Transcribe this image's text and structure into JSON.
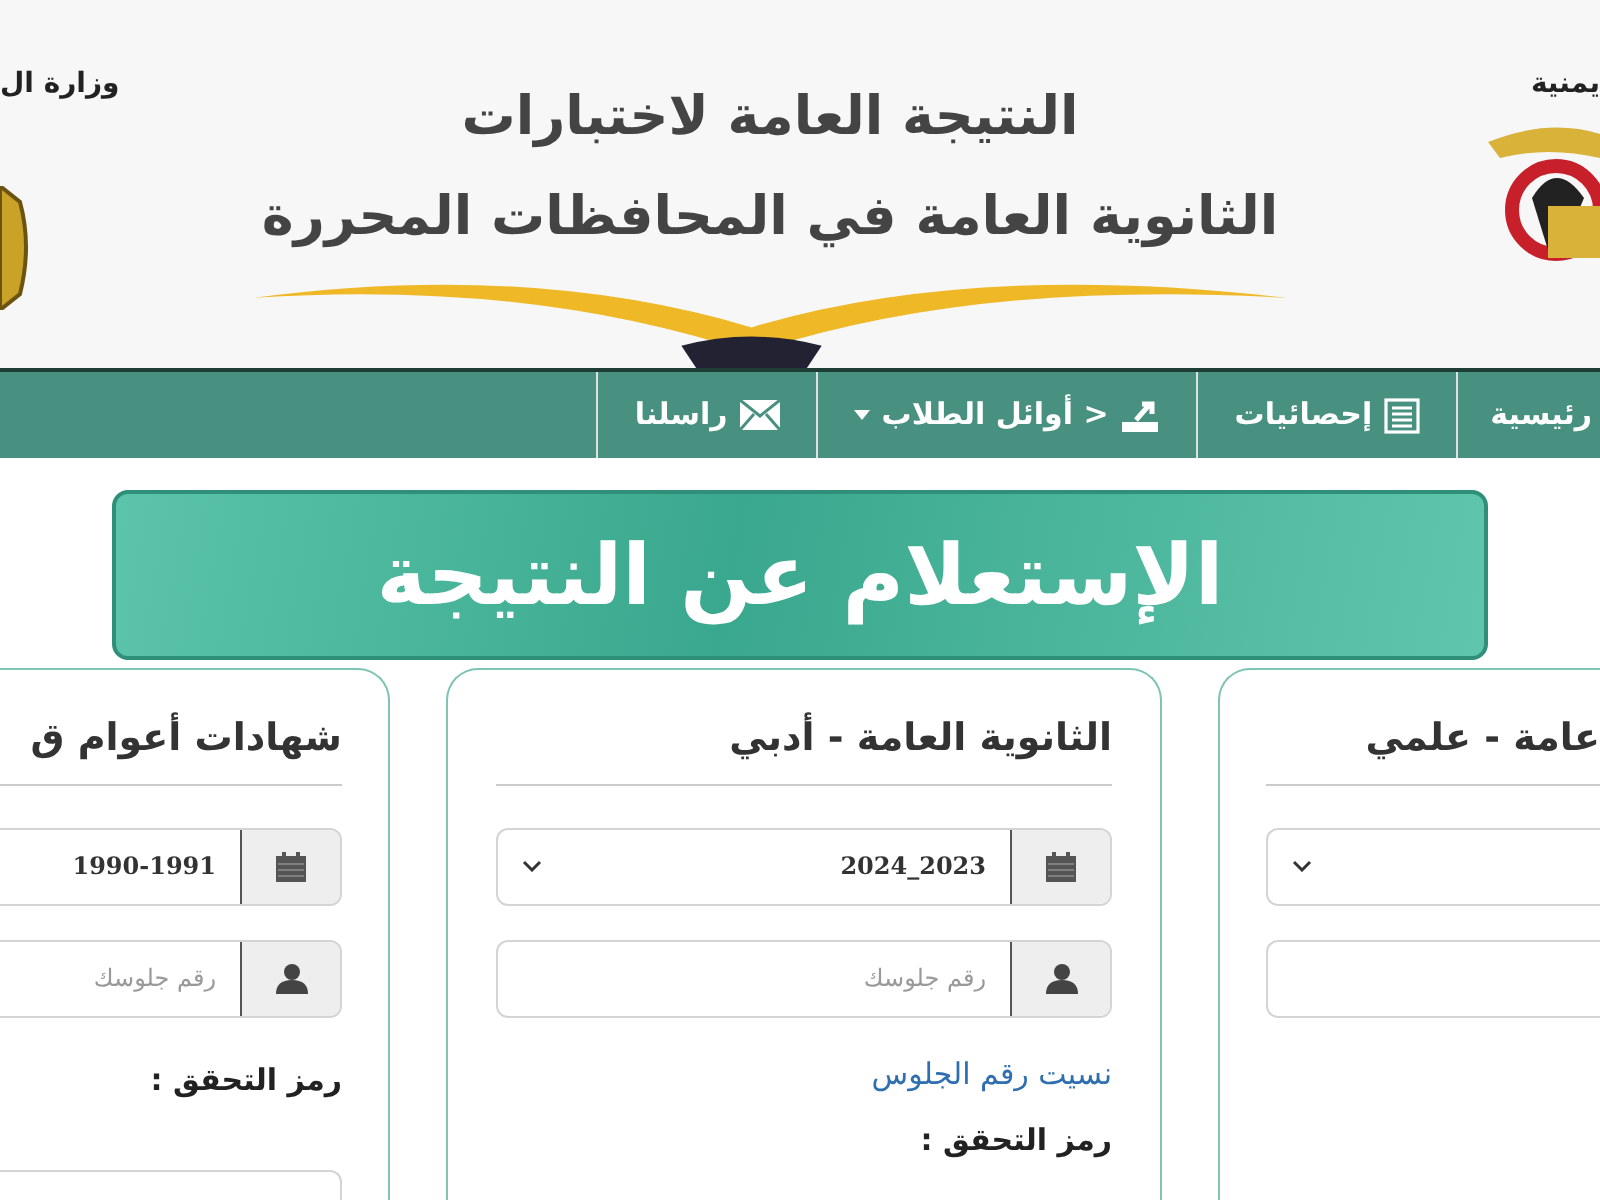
{
  "header": {
    "title_lines": [
      "النتيجة العامة لاختبارات",
      "الثانوية العامة في المحافظات المحررة"
    ],
    "left_text": "وزارة ال",
    "right_text": "يمنية"
  },
  "nav": [
    {
      "label": "رئيسية",
      "dropdown": false
    },
    {
      "label": "إحصائيات",
      "dropdown": false
    },
    {
      "label": "< أوائل الطلاب",
      "dropdown": true
    },
    {
      "label": "راسلنا",
      "dropdown": false
    }
  ],
  "banner": {
    "title": "الإستعلام عن النتيجة"
  },
  "cards": [
    {
      "title": "عامة - علمي",
      "fields": [
        {
          "kind": "select"
        },
        {
          "kind": "seat"
        }
      ]
    },
    {
      "title": "الثانوية العامة - أدبي",
      "fields": [
        {
          "kind": "select",
          "value": "2024_2023"
        },
        {
          "kind": "seat",
          "placeholder": "رقم جلوسك"
        }
      ],
      "forgot_link": "نسيت رقم الجلوس",
      "captcha_label": "رمز التحقق :"
    },
    {
      "title": "شهادات أعوام ق",
      "fields": [
        {
          "kind": "select",
          "value": "1990-1991"
        },
        {
          "kind": "seat",
          "placeholder": "رقم جلوسك"
        }
      ],
      "captcha_label": "رمز التحقق :",
      "captcha_field": true
    }
  ]
}
